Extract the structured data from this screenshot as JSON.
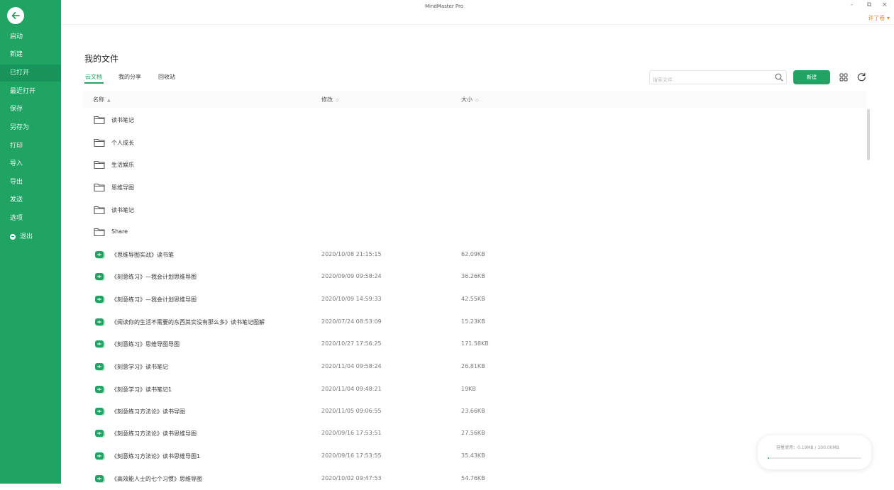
{
  "sidebar": {
    "items": [
      {
        "label": "启动"
      },
      {
        "label": "新建"
      },
      {
        "label": "已打开"
      },
      {
        "label": "最近打开"
      },
      {
        "label": "保存"
      },
      {
        "label": "另存为"
      },
      {
        "label": "打印"
      },
      {
        "label": "导入"
      },
      {
        "label": "导出"
      },
      {
        "label": "发送"
      },
      {
        "label": "选项"
      },
      {
        "label": "退出"
      }
    ]
  },
  "titlebar": {
    "app_title": "MindMaster Pro",
    "minimize": "-",
    "restore": "⧉",
    "close": "×",
    "user": "许了卷 ▾"
  },
  "main": {
    "page_title": "我的文件",
    "tabs": [
      {
        "label": "云文档"
      },
      {
        "label": "我的分享"
      },
      {
        "label": "回收站"
      }
    ],
    "search_placeholder": "搜索文件",
    "new_button": "新建",
    "columns": {
      "name": "名称",
      "date": "修改",
      "size": "大小",
      "sort": "▲",
      "sort_off": "◇"
    },
    "folders": [
      {
        "name": "读书笔记"
      },
      {
        "name": "个人成长"
      },
      {
        "name": "生活娱乐"
      },
      {
        "name": "思维导图"
      },
      {
        "name": "读书笔记"
      },
      {
        "name": "Share"
      }
    ],
    "files": [
      {
        "name": "《思维导图实战》读书笔",
        "date": "2020/10/08 21:15:15",
        "size": "62.09KB"
      },
      {
        "name": "《刻意练习》—我会计划思维导图",
        "date": "2020/09/09 09:58:24",
        "size": "36.26KB"
      },
      {
        "name": "《刻意练习》—我会计划思维导图",
        "date": "2020/10/09 14:59:33",
        "size": "42.55KB"
      },
      {
        "name": "《阅读你的生活不需要的东西其实没有那么多》读书笔记图解",
        "date": "2020/07/24 08:53:09",
        "size": "15.23KB"
      },
      {
        "name": "《刻意练习》思维导图导图",
        "date": "2020/10/27 17:56:25",
        "size": "171.58KB"
      },
      {
        "name": "《刻意学习》读书笔记",
        "date": "2020/11/04 09:58:24",
        "size": "26.81KB"
      },
      {
        "name": "《刻意学习》读书笔记1",
        "date": "2020/11/04 09:48:21",
        "size": "19KB"
      },
      {
        "name": "《刻意练习方法论》读书导图",
        "date": "2020/11/05 09:06:55",
        "size": "23.66KB"
      },
      {
        "name": "《刻意练习方法论》读书思维导图",
        "date": "2020/09/16 17:53:51",
        "size": "27.56KB"
      },
      {
        "name": "《刻意练习方法论》读书思维导图1",
        "date": "2020/09/16 17:53:55",
        "size": "35.43KB"
      },
      {
        "name": "《高效能人士的七个习惯》思维导图",
        "date": "2020/10/02 09:47:53",
        "size": "54.76KB"
      }
    ]
  },
  "progress": {
    "label": "容量使用：0.19MB / 100.00MB",
    "fraction": 0.002
  },
  "colors": {
    "accent": "#1fa463"
  }
}
